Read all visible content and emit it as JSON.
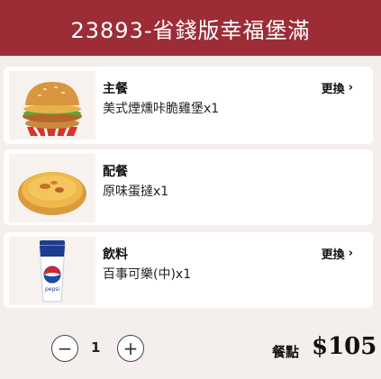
{
  "header": {
    "title": "23893-省錢版幸福堡滿"
  },
  "items": [
    {
      "category": "主餐",
      "name": "美式煙燻咔脆雞堡x1",
      "change_label": "更換",
      "image": "burger-image"
    },
    {
      "category": "配餐",
      "name": "原味蛋撻x1",
      "change_label": "",
      "image": "egg-tart-image"
    },
    {
      "category": "飲料",
      "name": "百事可樂(中)x1",
      "change_label": "更換",
      "image": "pepsi-cup-image"
    }
  ],
  "quantity": {
    "minus": "−",
    "value": "1",
    "plus": "+"
  },
  "footer": {
    "price_label": "餐點",
    "price": "$105"
  },
  "colors": {
    "header_bg": "#9c2c36",
    "page_bg": "#f4eeec"
  }
}
